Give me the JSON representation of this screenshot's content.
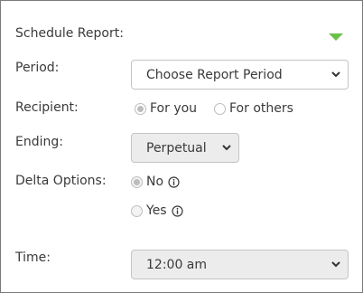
{
  "title": "Schedule Report:",
  "period": {
    "label": "Period:",
    "selected": "Choose Report Period"
  },
  "recipient": {
    "label": "Recipient:",
    "options": [
      "For you",
      "For others"
    ],
    "selected": "For you"
  },
  "ending": {
    "label": "Ending:",
    "selected": "Perpetual"
  },
  "delta": {
    "label": "Delta Options:",
    "options": [
      "No",
      "Yes"
    ],
    "selected": "No"
  },
  "time": {
    "label": "Time:",
    "selected": "12:00 am"
  },
  "colors": {
    "accent": "#6cc04a",
    "text": "#3a3a3a",
    "border": "#7a7a7a"
  },
  "icons": {
    "collapse": "caret-down-icon",
    "info": "info-icon",
    "dropdown": "chevron-down-icon"
  }
}
